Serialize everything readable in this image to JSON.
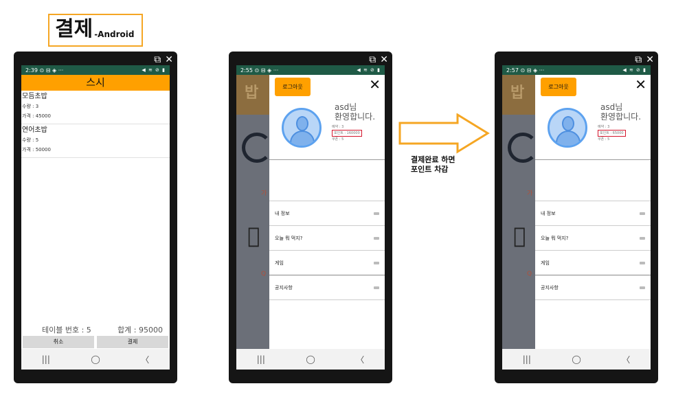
{
  "title": {
    "main": "결제",
    "sub": "-Android"
  },
  "status": {
    "time1": "2:39",
    "time2": "2:55",
    "time3": "2:57",
    "icons_left": "⊙ ⊟ ◈ ···",
    "icons_right": "◀ ≋ ⊘ ▮"
  },
  "window_controls": {
    "popout": "⧉",
    "close": "✕"
  },
  "nav": {
    "recent": "|||",
    "home": "◯",
    "back": "〈"
  },
  "phone1": {
    "appbar_title": "스시",
    "items": [
      {
        "name": "모듬초밥",
        "qty": "수량 : 3",
        "price": "가격 : 45000"
      },
      {
        "name": "연어초밥",
        "qty": "수량 : 5",
        "price": "가격 : 50000"
      }
    ],
    "table_no": "테이블 번호 : 5",
    "total": "합계 : 95000",
    "cancel": "취소",
    "pay": "결제"
  },
  "drawer": {
    "logout": "로그아웃",
    "close": "✕",
    "greeting_line1": "asd님",
    "greeting_line2": "환영합니다.",
    "line_a": "예약 : 3",
    "line_c": "쿠폰 : 5",
    "menu": [
      "내 정보",
      "오늘 뭐 먹지?",
      "게임",
      "공지사항"
    ]
  },
  "phone2": {
    "points": "포인트 : 160000"
  },
  "phone3": {
    "points": "포인트 : 65000"
  },
  "background": {
    "brand": "밥",
    "text1": "가",
    "text2": "Q"
  },
  "caption": {
    "line1": "결제완료 하면",
    "line2": "포인트 차감"
  },
  "colors": {
    "accent": "#ffa000",
    "status_bar": "#1f5a46",
    "highlight": "#d3142b"
  }
}
